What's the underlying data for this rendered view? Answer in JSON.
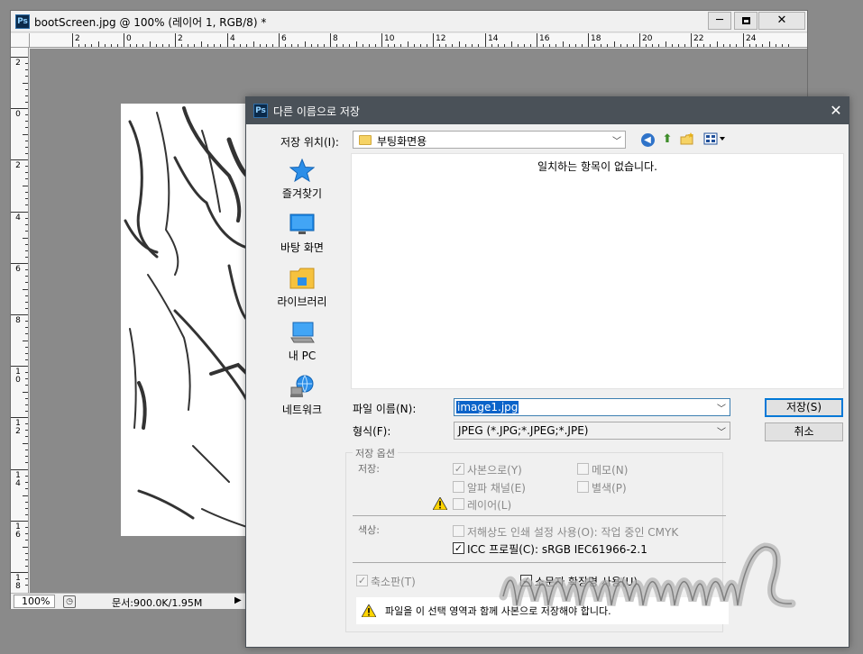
{
  "document": {
    "title": "bootScreen.jpg @ 100% (레이어 1, RGB/8) *",
    "window_buttons": {
      "minimize": "─",
      "close": "✕"
    },
    "ruler_top_labels": [
      "2",
      "0",
      "2",
      "4",
      "6",
      "8",
      "10",
      "12",
      "14",
      "16",
      "18",
      "20",
      "22",
      "24"
    ],
    "ruler_left_labels": [
      "2",
      "0",
      "2",
      "4",
      "6",
      "8",
      "1\n0",
      "1\n2",
      "1\n4",
      "1\n6",
      "1\n8"
    ],
    "zoom": "100%",
    "doc_size": "문서:900.0K/1.95M",
    "status_arrow": "▶"
  },
  "dialog": {
    "title": "다른 이름으로 저장",
    "close_glyph": "✕",
    "save_location_label": "저장 위치(I):",
    "save_location_value": "부팅화면용",
    "places": [
      {
        "label": "즐겨찾기",
        "icon": "star-icon"
      },
      {
        "label": "바탕 화면",
        "icon": "desktop-icon"
      },
      {
        "label": "라이브러리",
        "icon": "library-icon"
      },
      {
        "label": "내 PC",
        "icon": "computer-icon"
      },
      {
        "label": "네트워크",
        "icon": "network-icon"
      }
    ],
    "empty_message": "일치하는 항목이 없습니다.",
    "filename_label": "파일 이름(N):",
    "filename_value": "image1.jpg",
    "format_label": "형식(F):",
    "format_value": "JPEG (*.JPG;*.JPEG;*.JPE)",
    "save_button": "저장(S)",
    "cancel_button": "취소",
    "options": {
      "group_title": "저장 옵션",
      "save_label": "저장:",
      "as_copy": {
        "label": "사본으로(Y)",
        "checked": true
      },
      "notes": {
        "label": "메모(N)",
        "checked": false
      },
      "alpha_channels": {
        "label": "알파 채널(E)",
        "checked": false
      },
      "spot_colors": {
        "label": "별색(P)",
        "checked": false
      },
      "layers": {
        "label": "레이어(L)",
        "checked": false
      },
      "color_label": "색상:",
      "proof_setup": {
        "label": "저해상도 인쇄 설정 사용(O):  작업 중인 CMYK",
        "checked": false
      },
      "icc_profile": {
        "label": "ICC 프로필(C):  sRGB IEC61966-2.1",
        "checked": true
      },
      "thumbnail": {
        "label": "축소판(T)",
        "checked": true
      },
      "lowercase_ext": {
        "label": "소문자 확장명 사용(U)",
        "checked": true
      },
      "warning": "파일을 이 선택 영역과 함께 사본으로 저장해야 합니다."
    }
  },
  "colors": {
    "dialog_title_bg": "#4a5158",
    "selection": "#0a63c9",
    "default_button_border": "#0078d7",
    "workspace": "#8a8a8a"
  }
}
